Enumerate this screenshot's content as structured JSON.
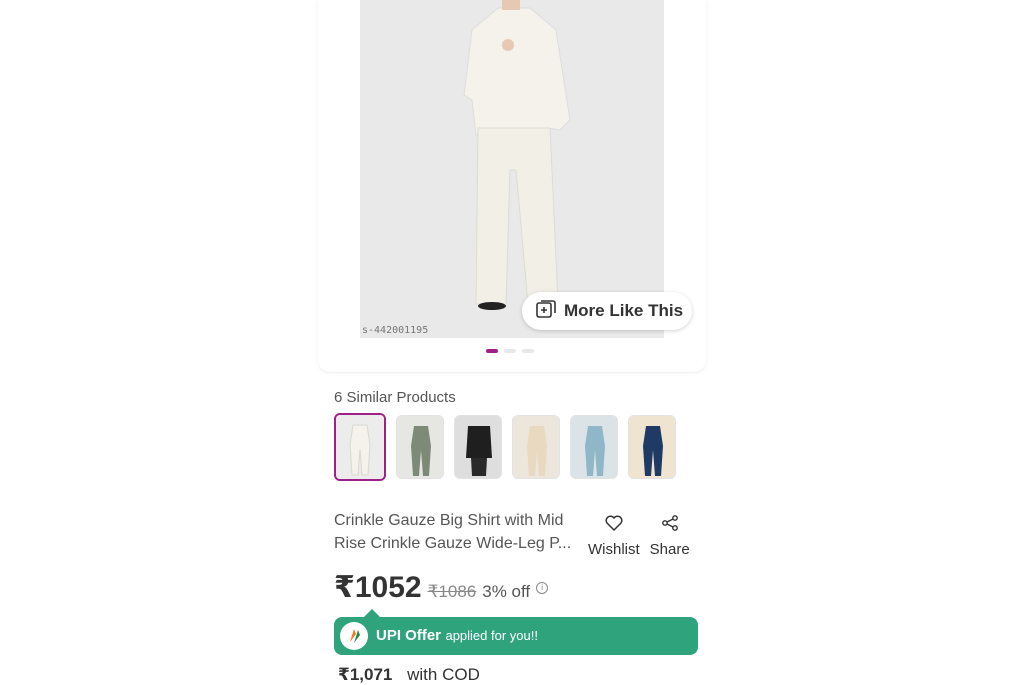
{
  "product": {
    "sku_watermark": "s-442001195",
    "more_like_this_label": "More Like This",
    "carousel_dots": 3,
    "carousel_active_index": 0
  },
  "similar": {
    "title": "6 Similar Products",
    "thumbnails": [
      {
        "name": "white-set",
        "color": "#ececec",
        "garment": "#f4f2ea"
      },
      {
        "name": "olive-set",
        "color": "#e6e6e3",
        "garment": "#7d8a78"
      },
      {
        "name": "black-set",
        "color": "#dedede",
        "garment": "#1f1f1f"
      },
      {
        "name": "beige-set",
        "color": "#ece6dc",
        "garment": "#e9d9c1"
      },
      {
        "name": "blue-set",
        "color": "#dbe3e6",
        "garment": "#8fb7c7"
      },
      {
        "name": "navy-set",
        "color": "#efe4cf",
        "garment": "#203a66"
      }
    ]
  },
  "details": {
    "title": "Crinkle Gauze Big Shirt with Mid Rise Crinkle Gauze Wide-Leg P...",
    "wishlist_label": "Wishlist",
    "share_label": "Share"
  },
  "pricing": {
    "price": "₹1052",
    "mrp": "₹1086",
    "discount": "3% off",
    "info_icon": "i"
  },
  "offer": {
    "strong": "UPI Offer",
    "small": "applied for you!!"
  },
  "cod": {
    "price": "₹1,071",
    "label": "with COD"
  },
  "colors": {
    "accent": "#9f2089",
    "offer_green": "#2fa47c"
  }
}
